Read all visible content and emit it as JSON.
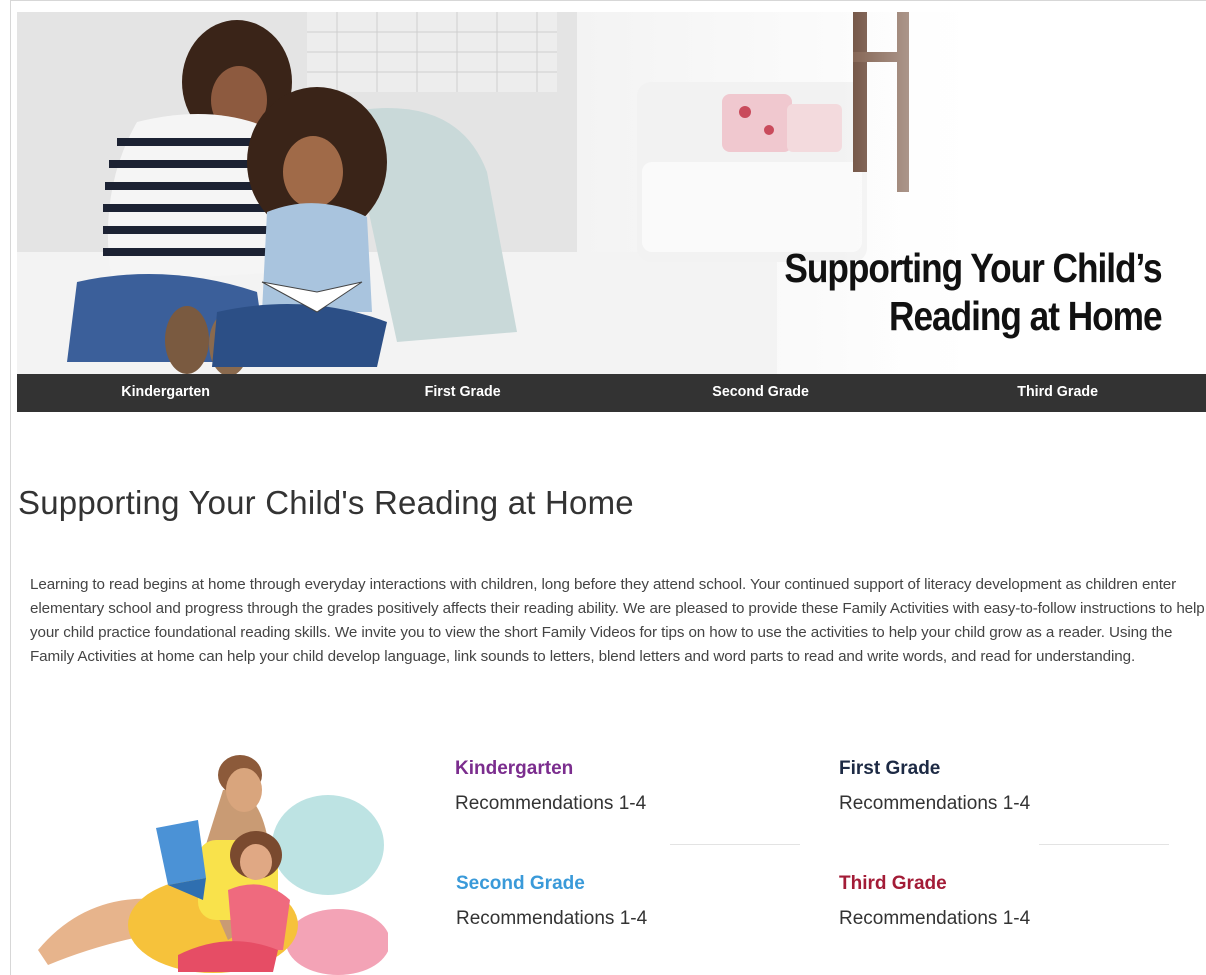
{
  "hero": {
    "title_line1": "Supporting Your Child’s",
    "title_line2": "Reading at Home"
  },
  "nav": {
    "items": [
      {
        "label": "Kindergarten"
      },
      {
        "label": "First Grade"
      },
      {
        "label": "Second Grade"
      },
      {
        "label": "Third Grade"
      }
    ]
  },
  "main": {
    "title": "Supporting Your Child's Reading at Home",
    "intro": "Learning to read begins at home through everyday interactions with children, long before they attend school. Your continued support of literacy development as children enter elementary school and progress through the grades positively affects their reading ability. We are pleased to provide these Family Activities with easy-to-follow instructions to help your child practice foundational reading skills. We invite you to view the short Family Videos for tips on how to use the activities to help your child grow as a reader. Using the Family Activities at home can help your child develop language, link sounds to letters, blend letters and word parts to read and write words, and read for understanding."
  },
  "grades": [
    {
      "name": "Kindergarten",
      "recommendations": "Recommendations 1-4",
      "color": "#7b2d8e"
    },
    {
      "name": "First Grade",
      "recommendations": "Recommendations 1-4",
      "color": "#1d2a44"
    },
    {
      "name": "Second Grade",
      "recommendations": "Recommendations 1-4",
      "color": "#3a9ad9"
    },
    {
      "name": "Third Grade",
      "recommendations": "Recommendations 1-4",
      "color": "#a31c37"
    }
  ]
}
